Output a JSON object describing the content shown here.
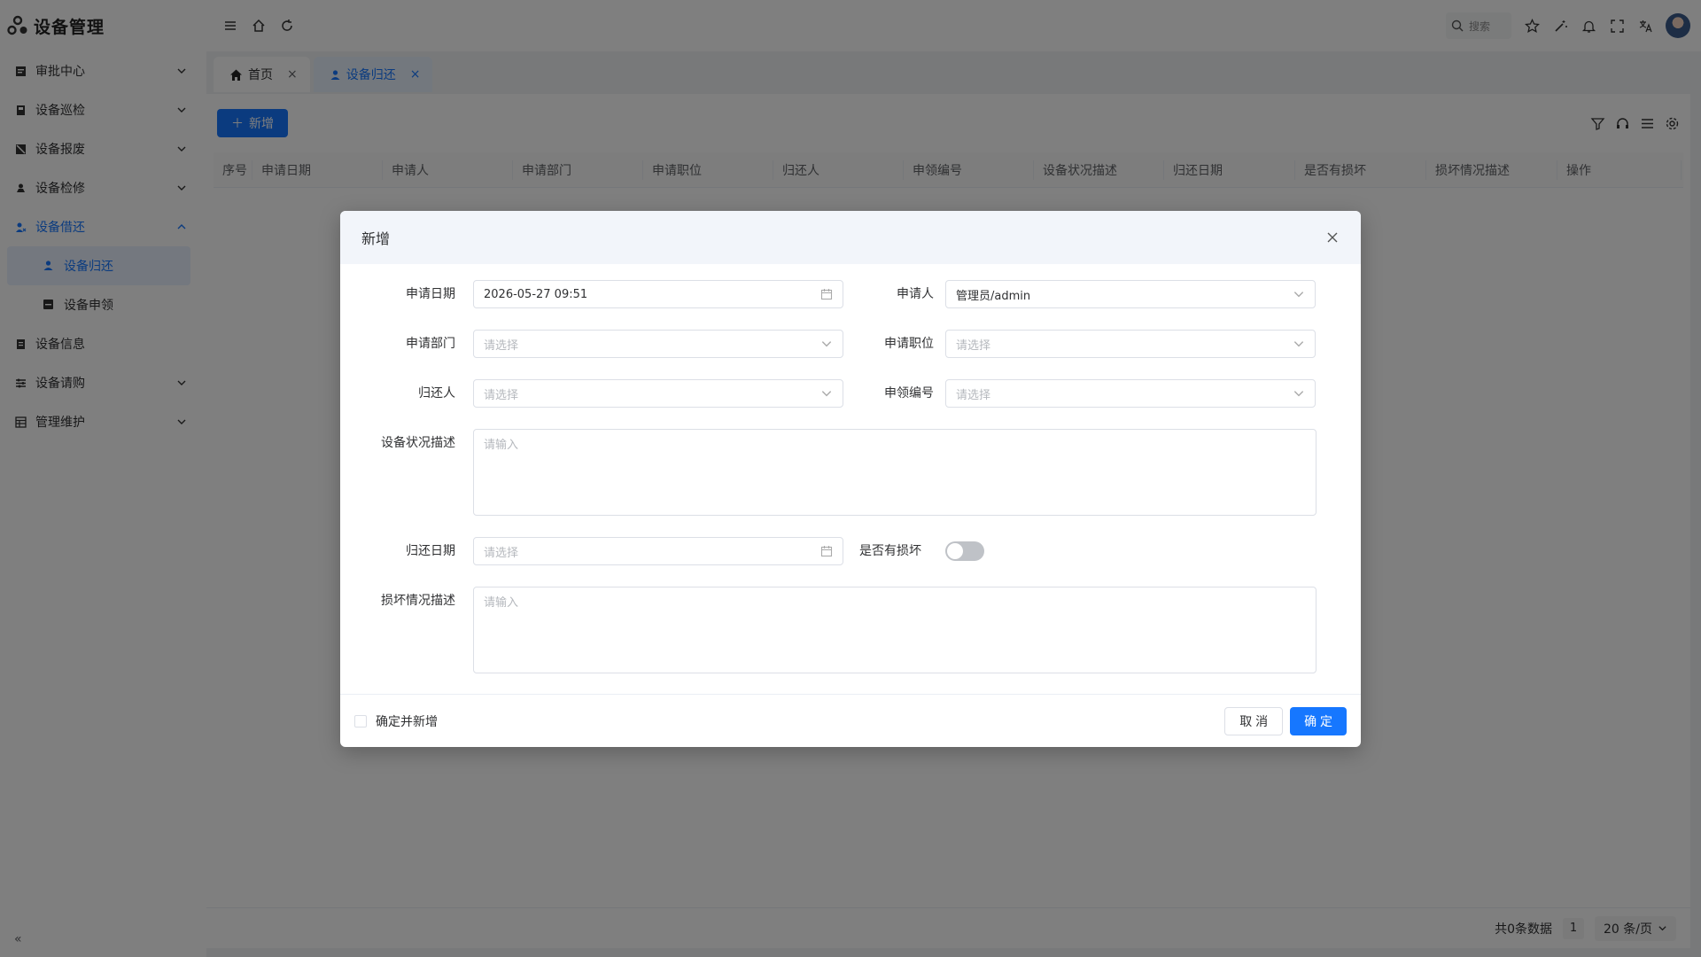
{
  "app": {
    "title": "设备管理"
  },
  "sidebar": {
    "items": [
      {
        "label": "审批中心",
        "icon": "approval-icon",
        "expandable": true
      },
      {
        "label": "设备巡检",
        "icon": "inspection-icon",
        "expandable": true
      },
      {
        "label": "设备报废",
        "icon": "scrap-icon",
        "expandable": true
      },
      {
        "label": "设备检修",
        "icon": "repair-icon",
        "expandable": true
      },
      {
        "label": "设备借还",
        "icon": "borrow-icon",
        "expandable": true,
        "expanded": true
      },
      {
        "label": "设备归还",
        "icon": "return-icon",
        "sub": true,
        "active": true
      },
      {
        "label": "设备申领",
        "icon": "claim-icon",
        "sub": true
      },
      {
        "label": "设备信息",
        "icon": "info-icon",
        "expandable": false
      },
      {
        "label": "设备请购",
        "icon": "purchase-icon",
        "expandable": true
      },
      {
        "label": "管理维护",
        "icon": "maintenance-icon",
        "expandable": true
      }
    ],
    "collapse_label": "«"
  },
  "header": {
    "search_placeholder": "搜索"
  },
  "tabs": [
    {
      "label": "首页",
      "icon": "home-icon"
    },
    {
      "label": "设备归还",
      "icon": "user-icon",
      "active": true
    }
  ],
  "toolbar": {
    "add_label": "新增"
  },
  "table": {
    "columns": [
      "序号",
      "申请日期",
      "申请人",
      "申请部门",
      "申请职位",
      "归还人",
      "申领编号",
      "设备状况描述",
      "归还日期",
      "是否有损坏",
      "损坏情况描述",
      "操作"
    ]
  },
  "pagination": {
    "total_text": "共0条数据",
    "current_page": "1",
    "page_size": "20 条/页"
  },
  "modal": {
    "title": "新增",
    "fields": {
      "apply_date": {
        "label": "申请日期",
        "value": "2026-05-27 09:51"
      },
      "applicant": {
        "label": "申请人",
        "value": "管理员/admin"
      },
      "department": {
        "label": "申请部门",
        "placeholder": "请选择"
      },
      "position": {
        "label": "申请职位",
        "placeholder": "请选择"
      },
      "returner": {
        "label": "归还人",
        "placeholder": "请选择"
      },
      "claim_no": {
        "label": "申领编号",
        "placeholder": "请选择"
      },
      "status_desc": {
        "label": "设备状况描述",
        "placeholder": "请输入"
      },
      "return_date": {
        "label": "归还日期",
        "placeholder": "请选择"
      },
      "damaged": {
        "label": "是否有损坏",
        "on": false
      },
      "damage_desc": {
        "label": "损坏情况描述",
        "placeholder": "请输入"
      }
    },
    "footer": {
      "confirm_and_add": "确定并新增",
      "cancel": "取 消",
      "ok": "确 定"
    }
  },
  "colors": {
    "primary": "#1677ff",
    "overlay": "rgba(0,0,0,0.5)"
  }
}
